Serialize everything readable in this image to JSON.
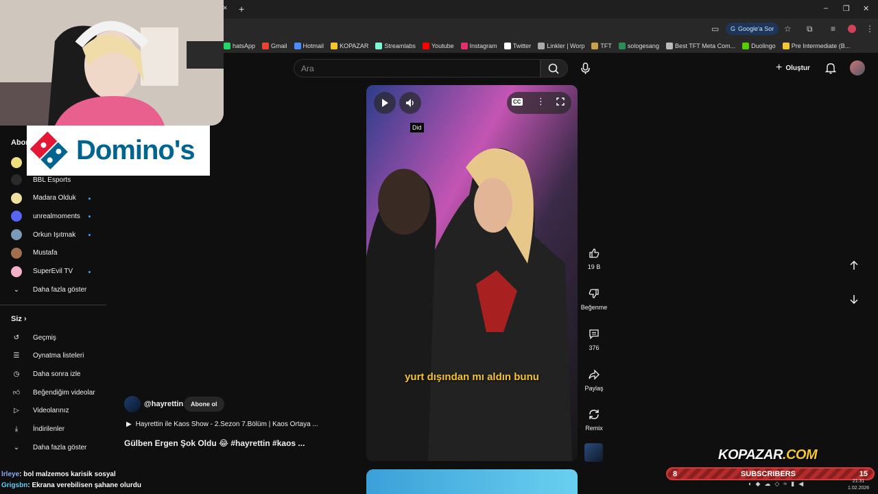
{
  "browser": {
    "tab_close": "×",
    "tab_new": "+",
    "google_sor": "Google'a Sor",
    "window_controls": [
      "–",
      "❐",
      "✕"
    ],
    "bookmarks": [
      {
        "label": "hatsApp",
        "color": "#25d366"
      },
      {
        "label": "Gmail",
        "color": "#ea4335"
      },
      {
        "label": "Hotmail",
        "color": "#4a8cff"
      },
      {
        "label": "KOPAZAR",
        "color": "#f5c531"
      },
      {
        "label": "Streamlabs",
        "color": "#80f5d2"
      },
      {
        "label": "Youtube",
        "color": "#ff0000"
      },
      {
        "label": "Instagram",
        "color": "#e1306c"
      },
      {
        "label": "Twitter",
        "color": "#ffffff"
      },
      {
        "label": "Linkler | Worp",
        "color": "#aaaaaa"
      },
      {
        "label": "TFT",
        "color": "#c8a24a"
      },
      {
        "label": "sologesang",
        "color": "#2e8b57"
      },
      {
        "label": "Best TFT Meta Com...",
        "color": "#bbbbbb"
      },
      {
        "label": "Duolingo",
        "color": "#58cc02"
      },
      {
        "label": "Pre Intermediate (B...",
        "color": "#f5c531"
      }
    ]
  },
  "header": {
    "search_placeholder": "Ara",
    "create_label": "Oluştur"
  },
  "sidebar": {
    "section_title": "Abon",
    "channels": [
      {
        "name": "BBL Esports",
        "color": "#2a2a2a",
        "dot": false
      },
      {
        "name": "Madara Olduk",
        "color": "#f0e0a0",
        "dot": true
      },
      {
        "name": "unrealmoments",
        "color": "#5865f2",
        "dot": true
      },
      {
        "name": "Orkun Işıtmak",
        "color": "#7a9ab8",
        "dot": true
      },
      {
        "name": "Mustafa",
        "color": "#a07050",
        "dot": false
      },
      {
        "name": "SuperEvil TV",
        "color": "#f4b0c8",
        "dot": true
      }
    ],
    "show_more_1": "Daha fazla göster",
    "you_title": "Siz",
    "you_items": [
      {
        "label": "Geçmiş",
        "icon": "history-icon"
      },
      {
        "label": "Oynatma listeleri",
        "icon": "playlists-icon"
      },
      {
        "label": "Daha sonra izle",
        "icon": "watch-later-icon"
      },
      {
        "label": "Beğendiğim videolar",
        "icon": "liked-icon"
      },
      {
        "label": "Videolarınız",
        "icon": "your-videos-icon"
      },
      {
        "label": "İndirilenler",
        "icon": "downloads-icon"
      }
    ],
    "show_more_2": "Daha fazla göster"
  },
  "overlay": {
    "sponsor": "Domino's"
  },
  "video": {
    "tooltip": "Did",
    "caption": "yurt dışından mı aldın bunu"
  },
  "actions": {
    "likes": "19 B",
    "dislike_label": "Beğenme",
    "comments": "376",
    "share_label": "Paylaş",
    "remix_label": "Remix"
  },
  "channel": {
    "handle": "@hayrettin",
    "subscribe_label": "Abone ol",
    "playlist_title": "Hayrettin ile Kaos Show - 2.Sezon 7.Bölüm | Kaos Ortaya ...",
    "video_title": "Gülben Ergen Şok Oldu 😂 #hayrettin #kaos ..."
  },
  "stream": {
    "kopazar_a": "KOPAZAR",
    "kopazar_b": ".COM",
    "subs_left": "8",
    "subs_label": "SUBSCRIBERS",
    "subs_right": "15",
    "chat": [
      {
        "user": "lrleye",
        "message": ": bol malzemos karisik sosyal"
      },
      {
        "user": "Grigsbn",
        "message": ": Ekrana verebilisen şahane olurdu"
      }
    ],
    "clock_time": "21:31",
    "clock_date": "1.02.2026"
  }
}
